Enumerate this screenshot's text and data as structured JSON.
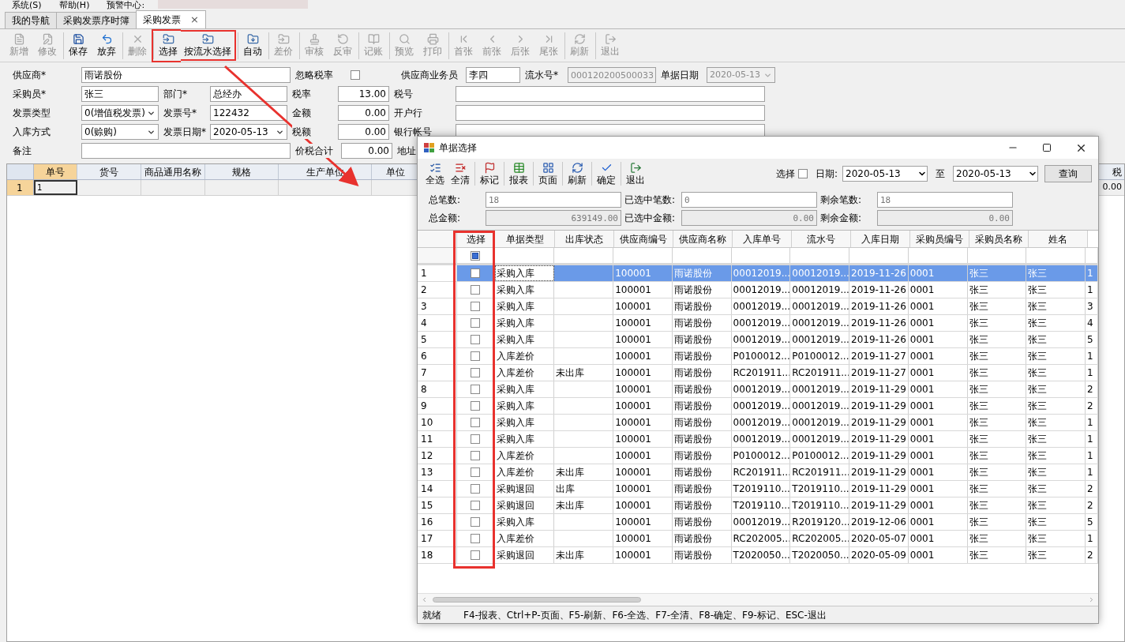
{
  "menu": [
    "系统(S)",
    "帮助(H)",
    "预警中心:"
  ],
  "tabs": [
    {
      "label": "我的导航",
      "selected": false,
      "closable": false
    },
    {
      "label": "采购发票序时簿",
      "selected": false,
      "closable": false
    },
    {
      "label": "采购发票",
      "selected": true,
      "closable": true
    }
  ],
  "close_glyph": "×",
  "toolbar": [
    {
      "label": "新增",
      "disabled": true,
      "separator_before": false,
      "highlighted": false
    },
    {
      "label": "修改",
      "disabled": true,
      "separator_before": false,
      "highlighted": false
    },
    {
      "label": "保存",
      "disabled": false,
      "separator_before": true,
      "highlighted": false
    },
    {
      "label": "放弃",
      "disabled": false,
      "separator_before": false,
      "highlighted": false
    },
    {
      "label": "删除",
      "disabled": true,
      "separator_before": true,
      "highlighted": false
    },
    {
      "label": "选择",
      "disabled": false,
      "separator_before": true,
      "highlighted": true
    },
    {
      "label": "按流水选择",
      "disabled": false,
      "separator_before": false,
      "highlighted": true
    },
    {
      "label": "自动",
      "disabled": false,
      "separator_before": true,
      "highlighted": false
    },
    {
      "label": "差价",
      "disabled": true,
      "separator_before": true,
      "highlighted": false
    },
    {
      "label": "审核",
      "disabled": true,
      "separator_before": true,
      "highlighted": false
    },
    {
      "label": "反审",
      "disabled": true,
      "separator_before": false,
      "highlighted": false
    },
    {
      "label": "记账",
      "disabled": true,
      "separator_before": true,
      "highlighted": false
    },
    {
      "label": "预览",
      "disabled": true,
      "separator_before": true,
      "highlighted": false
    },
    {
      "label": "打印",
      "disabled": true,
      "separator_before": false,
      "highlighted": false
    },
    {
      "label": "首张",
      "disabled": true,
      "separator_before": true,
      "highlighted": false
    },
    {
      "label": "前张",
      "disabled": true,
      "separator_before": false,
      "highlighted": false
    },
    {
      "label": "后张",
      "disabled": true,
      "separator_before": false,
      "highlighted": false
    },
    {
      "label": "尾张",
      "disabled": true,
      "separator_before": false,
      "highlighted": false
    },
    {
      "label": "刷新",
      "disabled": true,
      "separator_before": true,
      "highlighted": false
    },
    {
      "label": "退出",
      "disabled": true,
      "separator_before": true,
      "highlighted": false
    }
  ],
  "form": {
    "rows": [
      [
        {
          "kind": "text",
          "label": "供应商*",
          "value": "雨诺股份",
          "disabled": false
        },
        {
          "kind": "checkbox",
          "label": "忽略税率",
          "checked": false
        },
        {
          "kind": "text",
          "label": "供应商业务员",
          "value": "李四",
          "disabled": false
        },
        {
          "kind": "text",
          "label": "流水号*",
          "value": "000120200500033",
          "disabled": true
        },
        {
          "kind": "dropdown",
          "label": "单据日期",
          "value": "2020-05-13",
          "disabled": true
        }
      ],
      [
        {
          "kind": "text",
          "label": "采购员*",
          "value": "张三",
          "disabled": false
        },
        {
          "kind": "text",
          "label": "部门*",
          "value": "总经办",
          "disabled": false
        },
        {
          "kind": "number",
          "label": "税率",
          "value": "13.00",
          "disabled": false
        },
        {
          "kind": "text",
          "label": "税号",
          "disabled": false
        }
      ],
      [
        {
          "kind": "dropdown",
          "label": "发票类型",
          "value": "0(增值税发票)",
          "disabled": false
        },
        {
          "kind": "text",
          "label": "发票号*",
          "value": "122432",
          "disabled": false
        },
        {
          "kind": "number",
          "label": "金额",
          "value": "0.00",
          "disabled": false
        },
        {
          "kind": "text",
          "label": "开户行",
          "disabled": false
        }
      ],
      [
        {
          "kind": "dropdown",
          "label": "入库方式",
          "value": "0(赊购)",
          "disabled": false
        },
        {
          "kind": "dropdown",
          "label": "发票日期*",
          "value": "2020-05-13",
          "disabled": false
        },
        {
          "kind": "number",
          "label": "税额",
          "value": "0.00",
          "disabled": false
        },
        {
          "kind": "text",
          "label": "银行帐号",
          "disabled": false
        }
      ],
      [
        {
          "kind": "text",
          "label": "备注",
          "disabled": false
        },
        {
          "kind": "number",
          "label": "价税合计",
          "value": "0.00",
          "disabled": false
        },
        {
          "kind": "label",
          "label": "地址"
        }
      ]
    ]
  },
  "grid": {
    "columns": [
      "单号",
      "货号",
      "商品通用名称",
      "规格",
      "生产单位",
      "单位"
    ],
    "right_column": "税",
    "rows": [
      {
        "number": "1",
        "selected": true,
        "cells": [
          "1"
        ],
        "right_cell": "0.00"
      }
    ]
  },
  "dialog": {
    "title": "单据选择",
    "toolbar": [
      "全选",
      "全清",
      "标记",
      "报表",
      "页面",
      "刷新",
      "确定",
      "退出"
    ],
    "filter": {
      "select_label": "选择",
      "select_checked": false,
      "date_label": "日期:",
      "date_from": "2020-05-13",
      "to_label": "至",
      "date_to": "2020-05-13",
      "query_button": "查询"
    },
    "summary": [
      {
        "kind": "count",
        "label": "总笔数:",
        "value": "18"
      },
      {
        "kind": "count",
        "label": "已选中笔数:",
        "value": "0"
      },
      {
        "kind": "count",
        "label": "剩余笔数:",
        "value": "18"
      },
      {
        "kind": "amount",
        "label": "总金额:",
        "value": "639149.00"
      },
      {
        "kind": "amount",
        "label": "已选中金额:",
        "value": "0.00"
      },
      {
        "kind": "amount",
        "label": "剩余金额:",
        "value": "0.00"
      }
    ],
    "table": {
      "select_column": "选择",
      "select_column_highlighted": true,
      "columns": [
        "单据类型",
        "出库状态",
        "供应商编号",
        "供应商名称",
        "入库单号",
        "流水号",
        "入库日期",
        "采购员编号",
        "采购员名称",
        "姓名"
      ],
      "header_checkbox_checked": true,
      "rows": [
        {
          "number": "1",
          "selected": true,
          "checked": false,
          "cells": [
            "采购入库",
            "",
            "100001",
            "雨诺股份",
            "00012019...",
            "00012019...",
            "2019-11-26",
            "0001",
            "张三",
            "张三",
            "1"
          ]
        },
        {
          "number": "2",
          "selected": false,
          "checked": false,
          "cells": [
            "采购入库",
            "",
            "100001",
            "雨诺股份",
            "00012019...",
            "00012019...",
            "2019-11-26",
            "0001",
            "张三",
            "张三",
            "1"
          ]
        },
        {
          "number": "3",
          "selected": false,
          "checked": false,
          "cells": [
            "采购入库",
            "",
            "100001",
            "雨诺股份",
            "00012019...",
            "00012019...",
            "2019-11-26",
            "0001",
            "张三",
            "张三",
            "3"
          ]
        },
        {
          "number": "4",
          "selected": false,
          "checked": false,
          "cells": [
            "采购入库",
            "",
            "100001",
            "雨诺股份",
            "00012019...",
            "00012019...",
            "2019-11-26",
            "0001",
            "张三",
            "张三",
            "4"
          ]
        },
        {
          "number": "5",
          "selected": false,
          "checked": false,
          "cells": [
            "采购入库",
            "",
            "100001",
            "雨诺股份",
            "00012019...",
            "00012019...",
            "2019-11-26",
            "0001",
            "张三",
            "张三",
            "5"
          ]
        },
        {
          "number": "6",
          "selected": false,
          "checked": false,
          "cells": [
            "入库差价",
            "",
            "100001",
            "雨诺股份",
            "P0100012...",
            "P0100012...",
            "2019-11-27",
            "0001",
            "张三",
            "张三",
            "1"
          ]
        },
        {
          "number": "7",
          "selected": false,
          "checked": false,
          "cells": [
            "入库差价",
            "未出库",
            "100001",
            "雨诺股份",
            "RC201911...",
            "RC201911...",
            "2019-11-27",
            "0001",
            "张三",
            "张三",
            "1"
          ]
        },
        {
          "number": "8",
          "selected": false,
          "checked": false,
          "cells": [
            "采购入库",
            "",
            "100001",
            "雨诺股份",
            "00012019...",
            "00012019...",
            "2019-11-29",
            "0001",
            "张三",
            "张三",
            "2"
          ]
        },
        {
          "number": "9",
          "selected": false,
          "checked": false,
          "cells": [
            "采购入库",
            "",
            "100001",
            "雨诺股份",
            "00012019...",
            "00012019...",
            "2019-11-29",
            "0001",
            "张三",
            "张三",
            "2"
          ]
        },
        {
          "number": "10",
          "selected": false,
          "checked": false,
          "cells": [
            "采购入库",
            "",
            "100001",
            "雨诺股份",
            "00012019...",
            "00012019...",
            "2019-11-29",
            "0001",
            "张三",
            "张三",
            "1"
          ]
        },
        {
          "number": "11",
          "selected": false,
          "checked": false,
          "cells": [
            "采购入库",
            "",
            "100001",
            "雨诺股份",
            "00012019...",
            "00012019...",
            "2019-11-29",
            "0001",
            "张三",
            "张三",
            "1"
          ]
        },
        {
          "number": "12",
          "selected": false,
          "checked": false,
          "cells": [
            "入库差价",
            "",
            "100001",
            "雨诺股份",
            "P0100012...",
            "P0100012...",
            "2019-11-29",
            "0001",
            "张三",
            "张三",
            "1"
          ]
        },
        {
          "number": "13",
          "selected": false,
          "checked": false,
          "cells": [
            "入库差价",
            "未出库",
            "100001",
            "雨诺股份",
            "RC201911...",
            "RC201911...",
            "2019-11-29",
            "0001",
            "张三",
            "张三",
            "1"
          ]
        },
        {
          "number": "14",
          "selected": false,
          "checked": false,
          "cells": [
            "采购退回",
            "出库",
            "100001",
            "雨诺股份",
            "T2019110...",
            "T2019110...",
            "2019-11-29",
            "0001",
            "张三",
            "张三",
            "2"
          ]
        },
        {
          "number": "15",
          "selected": false,
          "checked": false,
          "cells": [
            "采购退回",
            "未出库",
            "100001",
            "雨诺股份",
            "T2019110...",
            "T2019110...",
            "2019-11-29",
            "0001",
            "张三",
            "张三",
            "2"
          ]
        },
        {
          "number": "16",
          "selected": false,
          "checked": false,
          "cells": [
            "采购入库",
            "",
            "100001",
            "雨诺股份",
            "00012019...",
            "R2019120...",
            "2019-12-06",
            "0001",
            "张三",
            "张三",
            "5"
          ]
        },
        {
          "number": "17",
          "selected": false,
          "checked": false,
          "cells": [
            "入库差价",
            "",
            "100001",
            "雨诺股份",
            "RC202005...",
            "RC202005...",
            "2020-05-07",
            "0001",
            "张三",
            "张三",
            "1"
          ]
        },
        {
          "number": "18",
          "selected": false,
          "checked": false,
          "cells": [
            "采购退回",
            "未出库",
            "100001",
            "雨诺股份",
            "T2020050...",
            "T2020050...",
            "2020-05-09",
            "0001",
            "张三",
            "张三",
            "2"
          ]
        }
      ]
    },
    "status_bar": {
      "state": "就绪",
      "hint": "F4-报表、Ctrl+P-页面、F5-刷新、F6-全选、F7-全清、F8-确定、F9-标记、ESC-退出"
    }
  }
}
